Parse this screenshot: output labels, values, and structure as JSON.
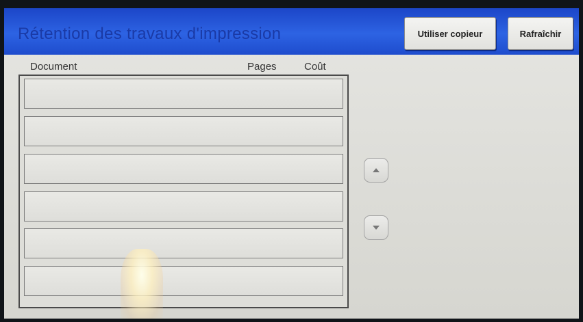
{
  "header": {
    "title": "Rétention des travaux d'impression",
    "use_copier_label": "Utiliser copieur",
    "refresh_label": "Rafraîchir"
  },
  "table": {
    "columns": [
      "Document",
      "Pages",
      "Coût"
    ],
    "rows": [
      {
        "document": "",
        "pages": "",
        "cost": ""
      },
      {
        "document": "",
        "pages": "",
        "cost": ""
      },
      {
        "document": "",
        "pages": "",
        "cost": ""
      },
      {
        "document": "",
        "pages": "",
        "cost": ""
      },
      {
        "document": "",
        "pages": "",
        "cost": ""
      },
      {
        "document": "",
        "pages": "",
        "cost": ""
      }
    ]
  },
  "scroll": {
    "up_icon": "triangle-up-icon",
    "down_icon": "triangle-down-icon"
  },
  "colors": {
    "header_blue": "#2d63e3",
    "title_blue": "#1a3aa6",
    "panel_gray": "#dcdcd7"
  }
}
